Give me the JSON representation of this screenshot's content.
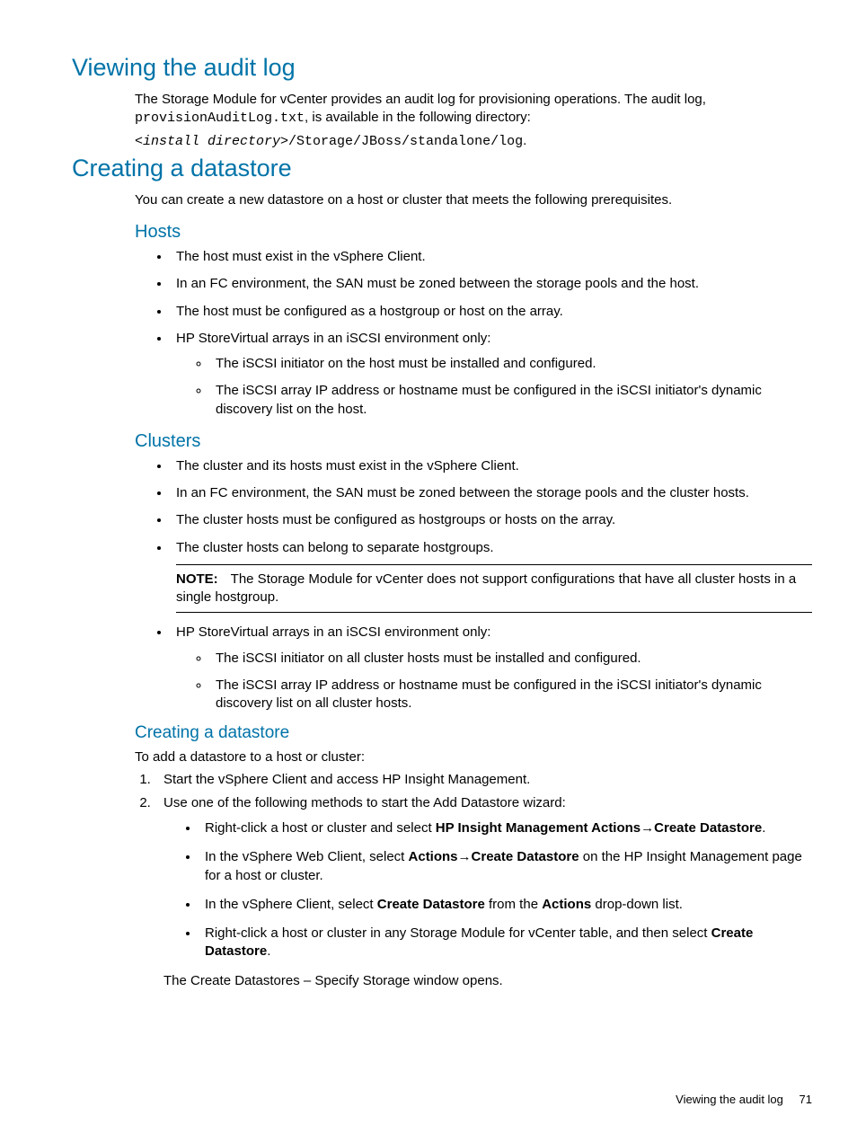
{
  "section1": {
    "title": "Viewing the audit log",
    "p1_a": "The Storage Module for vCenter provides an audit log for provisioning operations. The audit log, ",
    "p1_b": "provisionAuditLog.txt",
    "p1_c": ", is available in the following directory:",
    "path_a": "<install directory>",
    "path_b": "/Storage/JBoss/standalone/log",
    "path_c": "."
  },
  "section2": {
    "title": "Creating a datastore",
    "intro": "You can create a new datastore on a host or cluster that meets the following prerequisites.",
    "hosts": {
      "title": "Hosts",
      "items": [
        "The host must exist in the vSphere Client.",
        "In an FC environment, the SAN must be zoned between the storage pools and the host.",
        "The host must be configured as a hostgroup or host on the array.",
        "HP StoreVirtual arrays in an iSCSI environment only:"
      ],
      "subitems": [
        "The iSCSI initiator on the host must be installed and configured.",
        "The iSCSI array IP address or hostname must be configured in the iSCSI initiator's dynamic discovery list on the host."
      ]
    },
    "clusters": {
      "title": "Clusters",
      "items_a": [
        "The cluster and its hosts must exist in the vSphere Client.",
        "In an FC environment, the SAN must be zoned between the storage pools and the cluster hosts.",
        "The cluster hosts must be configured as hostgroups or hosts on the array.",
        "The cluster hosts can belong to separate hostgroups."
      ],
      "note_label": "NOTE:",
      "note_text": "The Storage Module for vCenter does not support configurations that have all cluster hosts in a single hostgroup.",
      "items_b": [
        "HP StoreVirtual arrays in an iSCSI environment only:"
      ],
      "subitems": [
        "The iSCSI initiator on all cluster hosts must be installed and configured.",
        "The iSCSI array IP address or hostname must be configured in the iSCSI initiator's dynamic discovery list on all cluster hosts."
      ]
    },
    "creating": {
      "title": "Creating a datastore",
      "intro": "To add a datastore to a host or cluster:",
      "step1": "Start the vSphere Client and access HP Insight Management.",
      "step2": "Use one of the following methods to start the Add Datastore wizard:",
      "m1_a": "Right-click a host or cluster and select ",
      "m1_b": "HP Insight Management Actions",
      "m1_c": "→",
      "m1_d": "Create Datastore",
      "m1_e": ".",
      "m2_a": "In the vSphere Web Client, select ",
      "m2_b": "Actions",
      "m2_c": "→",
      "m2_d": "Create Datastore",
      "m2_e": " on the HP Insight Management page for a host or cluster.",
      "m3_a": "In the vSphere Client, select ",
      "m3_b": "Create Datastore",
      "m3_c": " from the ",
      "m3_d": "Actions",
      "m3_e": " drop-down list.",
      "m4_a": "Right-click a host or cluster in any Storage Module for vCenter table, and then select ",
      "m4_b": "Create Datastore",
      "m4_c": ".",
      "result": "The Create Datastores – Specify Storage window opens."
    }
  },
  "footer": {
    "text": "Viewing the audit log",
    "page": "71"
  }
}
